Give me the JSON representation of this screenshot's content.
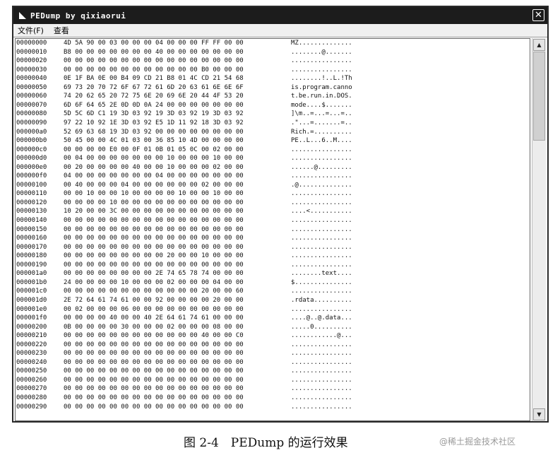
{
  "window": {
    "title": "PEDump by qixiaorui",
    "close_glyph": "✕"
  },
  "menu": [
    "文件(F)",
    "查看"
  ],
  "scrollbar": {
    "up_glyph": "▲",
    "down_glyph": "▼"
  },
  "rows": [
    {
      "offset": "00000000",
      "hex": "4D 5A 90 00 03 00 00 00 04 00 00 00 FF FF 00 00",
      "ascii": "MZ.............."
    },
    {
      "offset": "00000010",
      "hex": "B8 00 00 00 00 00 00 00 40 00 00 00 00 00 00 00",
      "ascii": "........@......."
    },
    {
      "offset": "00000020",
      "hex": "00 00 00 00 00 00 00 00 00 00 00 00 00 00 00 00",
      "ascii": "................"
    },
    {
      "offset": "00000030",
      "hex": "00 00 00 00 00 00 00 00 00 00 00 00 B0 00 00 00",
      "ascii": "................"
    },
    {
      "offset": "00000040",
      "hex": "0E 1F BA 0E 00 B4 09 CD 21 B8 01 4C CD 21 54 68",
      "ascii": "........!..L.!Th"
    },
    {
      "offset": "00000050",
      "hex": "69 73 20 70 72 6F 67 72 61 6D 20 63 61 6E 6E 6F",
      "ascii": "is.program.canno"
    },
    {
      "offset": "00000060",
      "hex": "74 20 62 65 20 72 75 6E 20 69 6E 20 44 4F 53 20",
      "ascii": "t.be.run.in.DOS."
    },
    {
      "offset": "00000070",
      "hex": "6D 6F 64 65 2E 0D 0D 0A 24 00 00 00 00 00 00 00",
      "ascii": "mode....$......."
    },
    {
      "offset": "00000080",
      "hex": "5D 5C 6D C1 19 3D 03 92 19 3D 03 92 19 3D 03 92",
      "ascii": "]\\m..=...=...=.."
    },
    {
      "offset": "00000090",
      "hex": "97 22 10 92 1E 3D 03 92 E5 1D 11 92 18 3D 03 92",
      "ascii": ".\"...=.......=.."
    },
    {
      "offset": "000000a0",
      "hex": "52 69 63 68 19 3D 03 92 00 00 00 00 00 00 00 00",
      "ascii": "Rich.=.........."
    },
    {
      "offset": "000000b0",
      "hex": "50 45 00 00 4C 01 03 00 36 85 10 4D 00 00 00 00",
      "ascii": "PE..L...6..M...."
    },
    {
      "offset": "000000c0",
      "hex": "00 00 00 00 E0 00 0F 01 0B 01 05 0C 00 02 00 00",
      "ascii": "................"
    },
    {
      "offset": "000000d0",
      "hex": "00 04 00 00 00 00 00 00 00 10 00 00 00 10 00 00",
      "ascii": "................"
    },
    {
      "offset": "000000e0",
      "hex": "00 20 00 00 00 00 40 00 00 10 00 00 00 02 00 00",
      "ascii": "......@........."
    },
    {
      "offset": "000000f0",
      "hex": "04 00 00 00 00 00 00 00 04 00 00 00 00 00 00 00",
      "ascii": "................"
    },
    {
      "offset": "00000100",
      "hex": "00 40 00 00 00 04 00 00 00 00 00 00 02 00 00 00",
      "ascii": ".@.............."
    },
    {
      "offset": "00000110",
      "hex": "00 00 10 00 00 10 00 00 00 00 10 00 00 10 00 00",
      "ascii": "................"
    },
    {
      "offset": "00000120",
      "hex": "00 00 00 00 10 00 00 00 00 00 00 00 00 00 00 00",
      "ascii": "................"
    },
    {
      "offset": "00000130",
      "hex": "10 20 00 00 3C 00 00 00 00 00 00 00 00 00 00 00",
      "ascii": "....<..........."
    },
    {
      "offset": "00000140",
      "hex": "00 00 00 00 00 00 00 00 00 00 00 00 00 00 00 00",
      "ascii": "................"
    },
    {
      "offset": "00000150",
      "hex": "00 00 00 00 00 00 00 00 00 00 00 00 00 00 00 00",
      "ascii": "................"
    },
    {
      "offset": "00000160",
      "hex": "00 00 00 00 00 00 00 00 00 00 00 00 00 00 00 00",
      "ascii": "................"
    },
    {
      "offset": "00000170",
      "hex": "00 00 00 00 00 00 00 00 00 00 00 00 00 00 00 00",
      "ascii": "................"
    },
    {
      "offset": "00000180",
      "hex": "00 00 00 00 00 00 00 00 00 20 00 00 10 00 00 00",
      "ascii": "................"
    },
    {
      "offset": "00000190",
      "hex": "00 00 00 00 00 00 00 00 00 00 00 00 00 00 00 00",
      "ascii": "................"
    },
    {
      "offset": "000001a0",
      "hex": "00 00 00 00 00 00 00 00 2E 74 65 78 74 00 00 00",
      "ascii": "........text...."
    },
    {
      "offset": "000001b0",
      "hex": "24 00 00 00 00 10 00 00 00 02 00 00 00 04 00 00",
      "ascii": "$..............."
    },
    {
      "offset": "000001c0",
      "hex": "00 00 00 00 00 00 00 00 00 00 00 00 20 00 00 60",
      "ascii": "................"
    },
    {
      "offset": "000001d0",
      "hex": "2E 72 64 61 74 61 00 00 92 00 00 00 00 20 00 00",
      "ascii": ".rdata.........."
    },
    {
      "offset": "000001e0",
      "hex": "00 02 00 00 00 06 00 00 00 00 00 00 00 00 00 00",
      "ascii": "................"
    },
    {
      "offset": "000001f0",
      "hex": "00 00 00 00 40 00 00 40 2E 64 61 74 61 00 00 00",
      "ascii": "....@..@.data..."
    },
    {
      "offset": "00000200",
      "hex": "0B 00 00 00 00 30 00 00 00 02 00 00 00 08 00 00",
      "ascii": ".....0.........."
    },
    {
      "offset": "00000210",
      "hex": "00 00 00 00 00 00 00 00 00 00 00 00 40 00 00 C0",
      "ascii": "............@..."
    },
    {
      "offset": "00000220",
      "hex": "00 00 00 00 00 00 00 00 00 00 00 00 00 00 00 00",
      "ascii": "................"
    },
    {
      "offset": "00000230",
      "hex": "00 00 00 00 00 00 00 00 00 00 00 00 00 00 00 00",
      "ascii": "................"
    },
    {
      "offset": "00000240",
      "hex": "00 00 00 00 00 00 00 00 00 00 00 00 00 00 00 00",
      "ascii": "................"
    },
    {
      "offset": "00000250",
      "hex": "00 00 00 00 00 00 00 00 00 00 00 00 00 00 00 00",
      "ascii": "................"
    },
    {
      "offset": "00000260",
      "hex": "00 00 00 00 00 00 00 00 00 00 00 00 00 00 00 00",
      "ascii": "................"
    },
    {
      "offset": "00000270",
      "hex": "00 00 00 00 00 00 00 00 00 00 00 00 00 00 00 00",
      "ascii": "................"
    },
    {
      "offset": "00000280",
      "hex": "00 00 00 00 00 00 00 00 00 00 00 00 00 00 00 00",
      "ascii": "................"
    },
    {
      "offset": "00000290",
      "hex": "00 00 00 00 00 00 00 00 00 00 00 00 00 00 00 00",
      "ascii": "................"
    }
  ],
  "caption": "图 2-4　PEDump 的运行效果",
  "watermark": "@稀土掘金技术社区"
}
